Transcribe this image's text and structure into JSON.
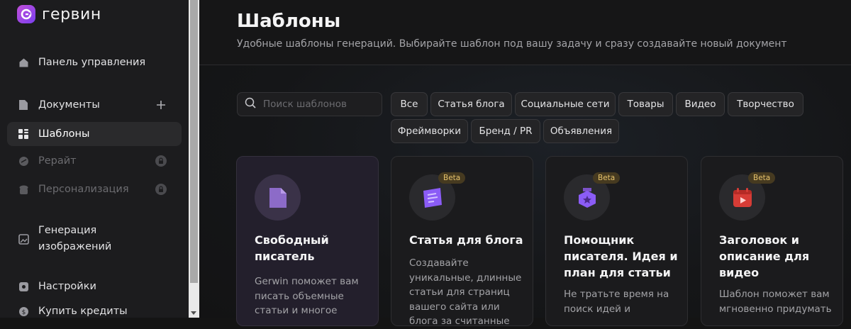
{
  "app": {
    "logo_text": "гервин",
    "logo_icon": "gerwin-logo-icon"
  },
  "sidebar": {
    "items": [
      {
        "label": "Панель управления",
        "icon": "home-icon"
      },
      {
        "label": "Документы",
        "icon": "document-icon",
        "action_icon": "plus-icon"
      },
      {
        "label": "Шаблоны",
        "icon": "grid-icon",
        "active": true
      },
      {
        "label": "Рерайт",
        "icon": "rewrite-icon",
        "locked": true,
        "lock_icon": "lock-icon"
      },
      {
        "label": "Персонализация",
        "icon": "persona-icon",
        "locked": true,
        "lock_icon": "lock-icon"
      },
      {
        "label": "Генерация изображений",
        "icon": "image-icon"
      },
      {
        "label": "Настройки",
        "icon": "settings-icon"
      },
      {
        "label": "Купить кредиты",
        "icon": "wallet-icon"
      }
    ]
  },
  "header": {
    "title": "Шаблоны",
    "subtitle": "Удобные шаблоны генераций. Выбирайте шаблон под вашу задачу и сразу создавайте новый документ"
  },
  "search": {
    "placeholder": "Поиск шаблонов",
    "icon": "search-icon"
  },
  "filters": [
    "Все",
    "Статья блога",
    "Социальные сети",
    "Товары",
    "Видео",
    "Творчество",
    "Фреймворки",
    "Бренд / PR",
    "Объявления"
  ],
  "cards": [
    {
      "title": "Свободный писатель",
      "description": "Gerwin поможет вам писать объемные статьи и многое",
      "icon": "document-icon",
      "beta": false
    },
    {
      "title": "Статья для блога",
      "description": "Создавайте уникальные, длинные статьи для страниц вашего сайта или блога за считанные",
      "icon": "blog-article-icon",
      "beta": true,
      "badge": "Beta"
    },
    {
      "title": "Помощник писателя. Идея и план для статьи",
      "description": "Не тратьте время на поиск идей и",
      "icon": "writer-badge-icon",
      "beta": true,
      "badge": "Beta"
    },
    {
      "title": "Заголовок и описание для видео",
      "description": "Шаблон поможет вам мгновенно придумать",
      "icon": "video-calendar-icon",
      "beta": true,
      "badge": "Beta"
    }
  ],
  "colors": {
    "accent": "#8b5cf6",
    "beta_text": "#e7c36b",
    "video_accent": "#e0443e"
  }
}
